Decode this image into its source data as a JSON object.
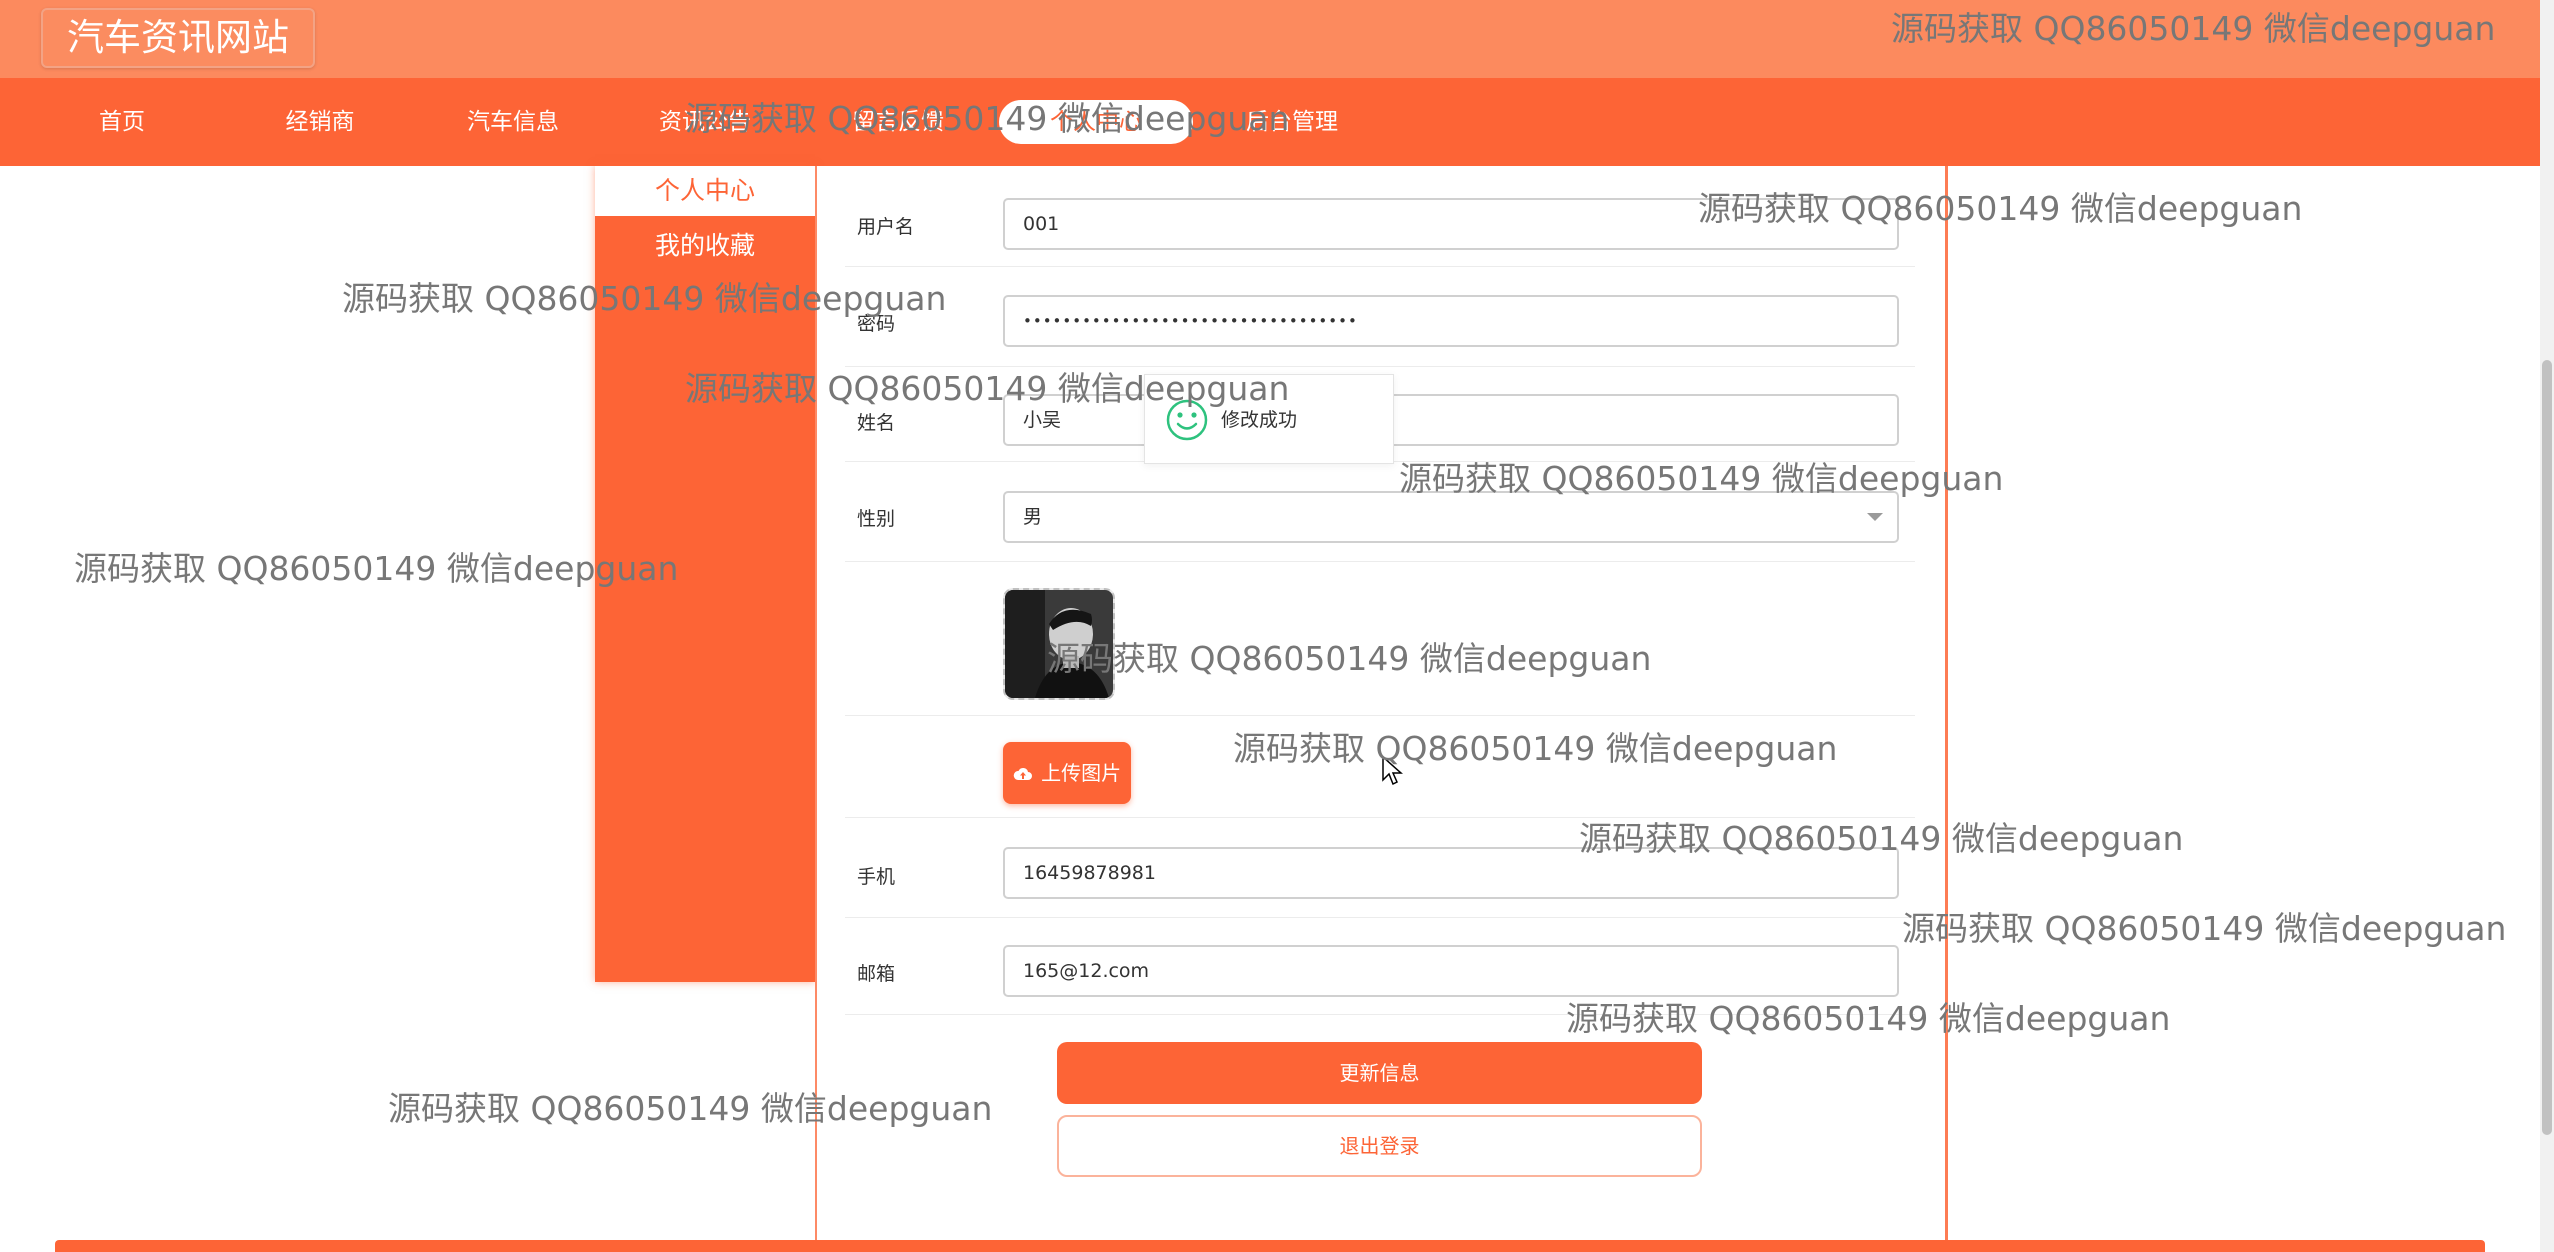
{
  "site": {
    "title": "汽车资讯网站"
  },
  "nav": {
    "items": [
      {
        "label": "首页"
      },
      {
        "label": "经销商"
      },
      {
        "label": "汽车信息"
      },
      {
        "label": "资讯公告"
      },
      {
        "label": "留言反馈"
      },
      {
        "label": "个人中心"
      },
      {
        "label": "后台管理"
      }
    ],
    "active": "个人中心"
  },
  "sidebar": {
    "items": [
      {
        "label": "个人中心"
      },
      {
        "label": "我的收藏"
      }
    ]
  },
  "form": {
    "username": {
      "label": "用户名",
      "value": "001"
    },
    "password": {
      "label": "密码",
      "value": "••••••••••••••••••••••••••••••••••"
    },
    "name": {
      "label": "姓名",
      "value": "小吴"
    },
    "gender": {
      "label": "性别",
      "value": "男"
    },
    "upload_label": "上传图片",
    "phone": {
      "label": "手机",
      "value": "16459878981"
    },
    "email": {
      "label": "邮箱",
      "value": "165@12.com"
    }
  },
  "actions": {
    "update_label": "更新信息",
    "logout_label": "退出登录"
  },
  "toast": {
    "message": "修改成功",
    "icon": "smile-icon"
  },
  "watermark": "源码获取 QQ86050149 微信deepguan",
  "colors": {
    "brand": "#fd6436",
    "topbar": "#fc8a5e",
    "toast_icon": "#2ec27e"
  }
}
